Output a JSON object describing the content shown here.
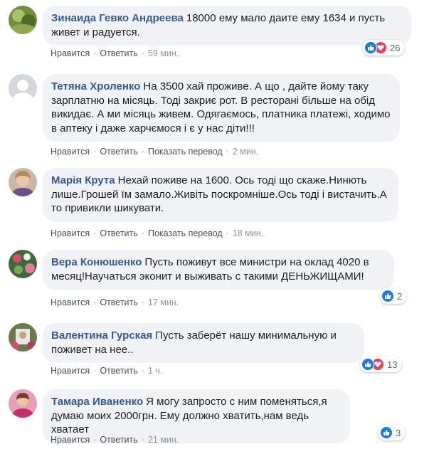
{
  "comments": [
    {
      "author": "Зинаида Гевко Андреева",
      "text": "18000 ему мало даите ему 1634 и пусть живет и радуется.",
      "actions": {
        "like": "Нравится",
        "reply": "Ответить",
        "translate": "",
        "time": "59 мин."
      },
      "reactions": {
        "count": "26",
        "icons": [
          "like-icon",
          "love-icon"
        ]
      }
    },
    {
      "author": "Тетяна Хроленко",
      "text": "На 3500 хай проживе. А що , дайте йому таку зарплатню на місяць. Тоді закриє рот. В ресторані більше на обід викидає. А ми місяць живем. Одягаємось, платника платежі, ходимо в аптеку і даже харчємося і є у нас діти!!!",
      "actions": {
        "like": "Нравится",
        "reply": "Ответить",
        "translate": "Показать перевод",
        "time": "2 мин."
      },
      "reactions": null
    },
    {
      "author": "Марія Крута",
      "text": "Нехай поживе на 1600. Ось тоді що скаже.Нинють лише.Грошей їм замало.Живіть поскромніше.Ось тоді і вистачить.А то привикли шикувати.",
      "actions": {
        "like": "Нравится",
        "reply": "Ответить",
        "translate": "Показать перевод",
        "time": "18 мин."
      },
      "reactions": null
    },
    {
      "author": "Вера Конюшенко",
      "text": "Пусть поживут все министри на оклад 4020 в месяц!Научаться эконит и выживать с такими ДЕНЬЖИЩАМИ!",
      "actions": {
        "like": "Нравится",
        "reply": "Ответить",
        "translate": "",
        "time": "17 мин."
      },
      "reactions": {
        "count": "2",
        "icons": [
          "like-icon"
        ]
      }
    },
    {
      "author": "Валентина Гурская",
      "text": "Пусть заберёт нашу минимальную и поживет на нее..",
      "actions": {
        "like": "Нравится",
        "reply": "Ответить",
        "translate": "",
        "time": "1 ч."
      },
      "reactions": {
        "count": "13",
        "icons": [
          "like-icon",
          "love-icon"
        ]
      }
    },
    {
      "author": "Тамара Иваненко",
      "text": "Я могу запросто с ним поменяться,я думаю моих 2000грн. Ему должно хватить,нам ведь хватает",
      "actions": {
        "like": "Нравится",
        "reply": "Ответить",
        "translate": "",
        "time": "21 мин."
      },
      "reactions": {
        "count": "3",
        "icons": [
          "like-icon"
        ]
      }
    }
  ],
  "colors": {
    "author": "#385898",
    "bubble": "#f0f2f5",
    "like": "#1877f2",
    "love": "#f33e58"
  }
}
